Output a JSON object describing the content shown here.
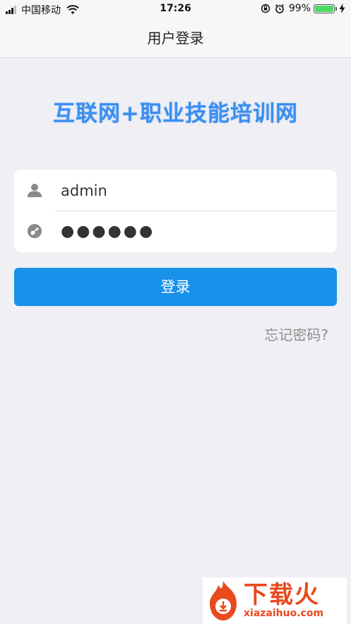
{
  "status_bar": {
    "carrier": "中国移动",
    "time": "17:26",
    "battery": "99%",
    "battery_level": 99
  },
  "nav": {
    "title": "用户登录"
  },
  "app": {
    "title": "互联网+职业技能培训网"
  },
  "form": {
    "username_value": "admin",
    "password_value": "●●●●●●"
  },
  "login_button": {
    "label": "登录"
  },
  "forgot_link": {
    "label": "忘记密码?"
  },
  "watermark": {
    "cn": "下载火",
    "en": "xiazaihuo.com"
  },
  "colors": {
    "accent": "#1891eb",
    "title": "#3a8ef0",
    "background": "#efeff4",
    "watermark": "#e84a1e"
  },
  "icons": {
    "username": "user-icon",
    "password": "key-icon",
    "wifi": "wifi-icon",
    "alarm": "alarm-icon",
    "lock_rotation": "rotation-lock-icon",
    "charging": "charging-icon"
  }
}
